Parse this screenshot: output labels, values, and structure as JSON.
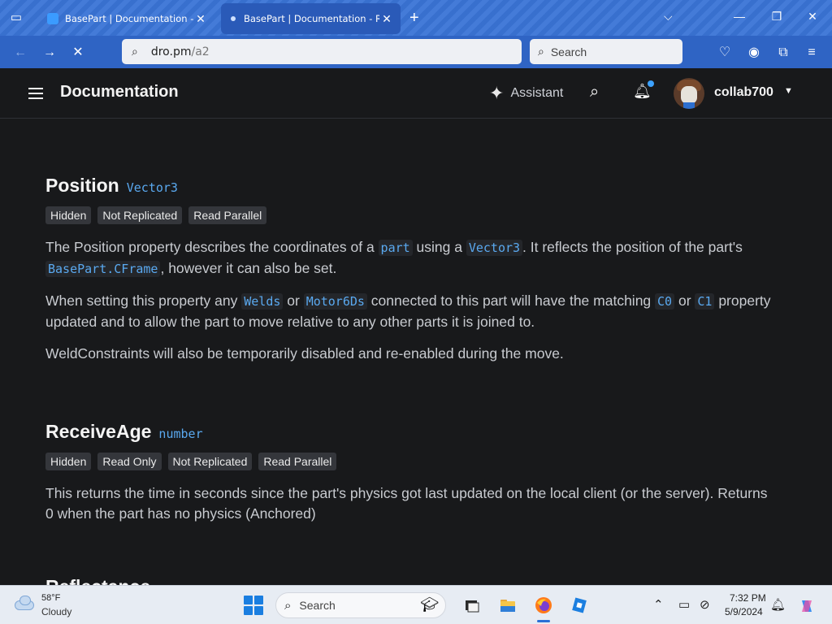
{
  "browser": {
    "tabs": [
      {
        "title": "BasePart | Documentation - Rob",
        "active": false
      },
      {
        "title": "BasePart | Documentation - Rob",
        "active": true
      }
    ],
    "url_host": "dro.pm",
    "url_path": "/a2",
    "search_placeholder": "Search",
    "icons": {
      "tab_list": "tab-list-icon",
      "new_tab": "plus-icon",
      "tabs_menu": "chevron-down-icon",
      "back": "arrow-left-icon",
      "forward": "arrow-right-icon",
      "stop": "close-icon",
      "pocket": "pocket-icon",
      "account": "account-icon",
      "extensions": "puzzle-icon",
      "menu": "hamburger-icon"
    },
    "accent": "#3a74d6"
  },
  "site": {
    "title": "Documentation",
    "assistant_label": "Assistant",
    "username": "collab700",
    "notification_dot_color": "#3da2ff"
  },
  "content": {
    "properties": [
      {
        "name": "Position",
        "type": "Vector3",
        "tags": [
          "Hidden",
          "Not Replicated",
          "Read Parallel"
        ]
      },
      {
        "name": "ReceiveAge",
        "type": "number",
        "tags": [
          "Hidden",
          "Read Only",
          "Not Replicated",
          "Read Parallel"
        ]
      }
    ],
    "position_p1": {
      "t1": "The Position property describes the coordinates of a ",
      "c1": "part",
      "t2": " using a ",
      "c2": "Vector3",
      "t3": ". It reflects the position of the part's ",
      "c3": "BasePart.CFrame",
      "t4": ", however it can also be set."
    },
    "position_p2": {
      "t1": "When setting this property any ",
      "c1": "Welds",
      "t2": " or ",
      "c2": "Motor6Ds",
      "t3": " connected to this part will have the matching ",
      "c3": "C0",
      "t4": " or ",
      "c4": "C1",
      "t5": " property updated and to allow the part to move relative to any other parts it is joined to."
    },
    "position_p3": "WeldConstraints will also be temporarily disabled and re-enabled during the move.",
    "receiveage_p1": "This returns the time in seconds since the part's physics got last updated on the local client (or the server). Returns 0 when the part has no physics (Anchored)",
    "next_heading": "Reflectance"
  },
  "taskbar": {
    "weather_temp": "58°F",
    "weather_desc": "Cloudy",
    "search_placeholder": "Search",
    "time": "7:32 PM",
    "date": "5/9/2024"
  }
}
